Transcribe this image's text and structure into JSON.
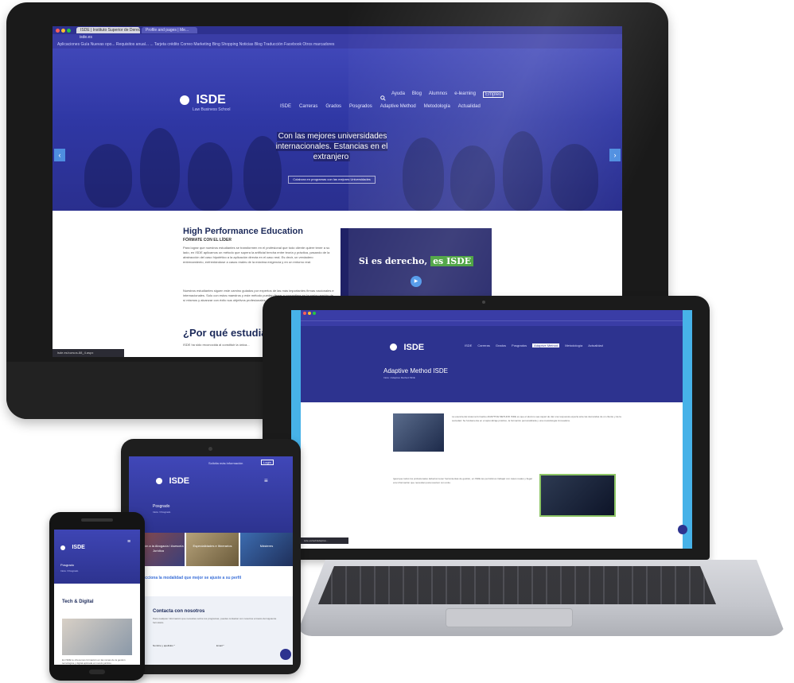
{
  "imac": {
    "browser": {
      "tab_active": "ISDE | Instituto Superior de Derecho y E...",
      "tab_second": "Profile and pages | Me...",
      "url": "isde.es",
      "bookmarks": "Aplicaciones  Guía  Nuevas opo...  Requisitos anual...  ...  Tarjeta crédito  Correo  Marketing  Bing  Shopping  Noticias  Blog  Traducción  Facebook  Otros marcadores"
    },
    "logo": {
      "name": "ISDE",
      "tagline": "Law Business School"
    },
    "topnav": [
      "Ayuda",
      "Blog",
      "Alumnos",
      "e-learning",
      "Empleo"
    ],
    "mainnav": [
      "ISDE",
      "Carreras",
      "Grados",
      "Posgrados",
      "Adaptive Method",
      "Metodología",
      "Actualidad"
    ],
    "hero": {
      "caption": "Con las mejores universidades internacionales. Estancias en el extranjero",
      "cta": "Colabora en programas con las mejores Universidades"
    },
    "content": {
      "title": "High Performance Education",
      "subtitle": "FÓRMATE CON EL LÍDER",
      "paragraph1": "Para lograr que nuestros estudiantes se transformen en el profesional que todo cliente quiere tener a su lado, en ISDE aplicamos un método que supera la artificial brecha entre teoría y práctica, pasando de la abstracción del caso hipotético a la aplicación directa en el caso real. Es decir, un verdadero entrenamiento, enfrentándose a casos reales de la máxima exigencia y en un entorno real.",
      "paragraph2": "Nuestros estudiantes siguen este camino guiados por expertos de las más importantes firmas nacionales e internacionales. Solo con estos maestros y este método pueden llegar a convertirse en la mejor versión de sí mismos y alcanzar con éxito sus objetivos profesionales.",
      "why_heading": "¿Por qué estudiar e",
      "why_sub": "ISDE ha sido reconocida al constituir la única..."
    },
    "video": {
      "text": "Si es derecho,",
      "highlight": "es ISDE"
    },
    "statusbar": "isde.es/cursos-88_4.aspx"
  },
  "laptop": {
    "page_title": "Adaptive Method ISDE",
    "breadcrumb": "Inicio / Adaptive Method ISDE",
    "nav": [
      "ISDE",
      "Carreras",
      "Grados",
      "Posgrados",
      "Adaptive Method",
      "Metodología",
      "Actualidad"
    ],
    "para1": "La esencia del sistema formativo ADAPTIVE METHOD ISDE es que el alumno sea capaz de dar una respuesta experta ante las demandas de un cliente y de la sociedad. Se fundamenta en el aprendizaje práctico, la formación personalizada y una metodología innovadora.",
    "para2": "Igual que todos los profesionales deberían tener herramientas de gestión, en ISDE les permitimos trabajar con casos reales y llegar a la información que necesitan para resolver con éxito.",
    "statusbar": "isde.es/web/adaptive..."
  },
  "tablet": {
    "topbar": "Solicita más información",
    "login": "Login",
    "page_title": "Posgrado",
    "breadcrumb": "Inicio / Posgrado",
    "cards": [
      "Formación a la Abogacía / Asesoría Jurídica",
      "Especialidades e Itinerarios",
      "Másteres"
    ],
    "select_label": "Selecciona la modalidad que mejor se ajuste a su perfil",
    "contact_title": "Contacta con nosotros",
    "contact_text": "Para cualquier información que necesites sobre tus programas, puedes contactar con nosotros a través del siguiente formulario.",
    "field1": "Nombre y apellidos *",
    "field2": "Email *"
  },
  "phone": {
    "page_title": "Posgrado",
    "breadcrumb": "Inicio / Posgrado",
    "section_title": "Tech & Digital",
    "text": "En ISDE te ofrecemos formación en las ramas de la gestión tecnológica y digital aplicada al mundo jurídico."
  }
}
